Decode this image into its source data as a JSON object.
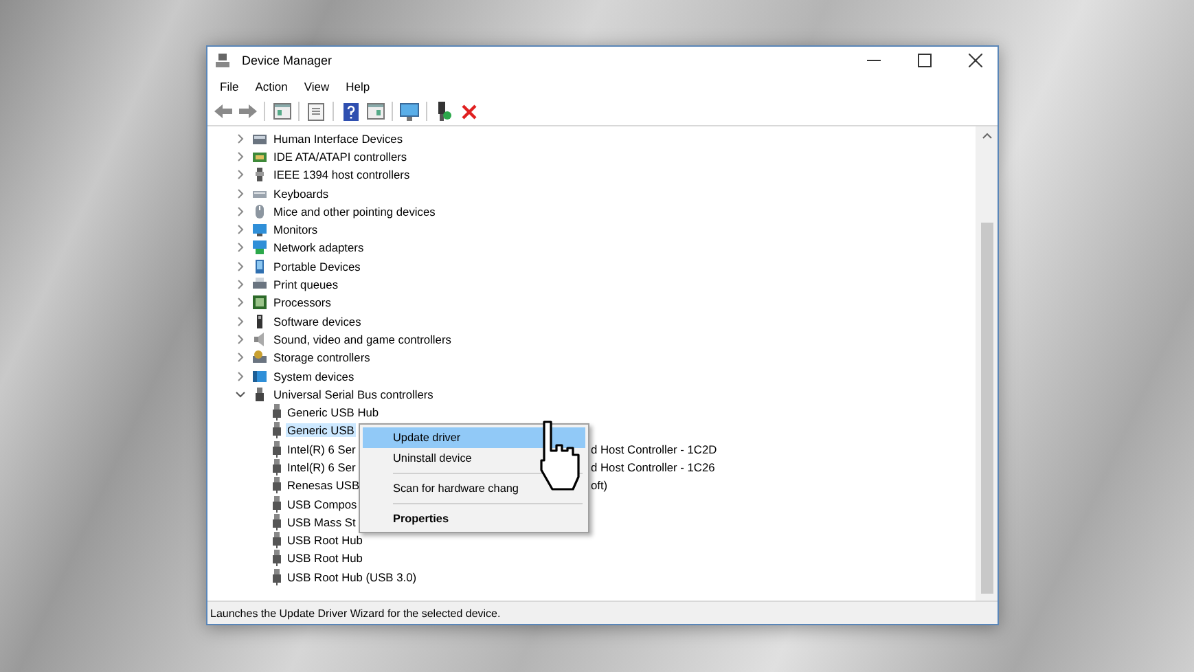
{
  "window": {
    "title": "Device Manager"
  },
  "menu_bar": [
    "File",
    "Action",
    "View",
    "Help"
  ],
  "tree": {
    "items": [
      {
        "label": "Human Interface Devices",
        "expanded": false
      },
      {
        "label": "IDE ATA/ATAPI controllers",
        "expanded": false
      },
      {
        "label": "IEEE 1394 host controllers",
        "expanded": false
      },
      {
        "label": "Keyboards",
        "expanded": false
      },
      {
        "label": "Mice and other pointing devices",
        "expanded": false
      },
      {
        "label": "Monitors",
        "expanded": false
      },
      {
        "label": "Network adapters",
        "expanded": false
      },
      {
        "label": "Portable Devices",
        "expanded": false
      },
      {
        "label": "Print queues",
        "expanded": false
      },
      {
        "label": "Processors",
        "expanded": false
      },
      {
        "label": "Software devices",
        "expanded": false
      },
      {
        "label": "Sound, video and game controllers",
        "expanded": false
      },
      {
        "label": "Storage controllers",
        "expanded": false
      },
      {
        "label": "System devices",
        "expanded": false
      },
      {
        "label": "Universal Serial Bus controllers",
        "expanded": true,
        "children": [
          {
            "label": "Generic USB Hub",
            "selected": false
          },
          {
            "label": "Generic USB",
            "selected": true
          },
          {
            "label": "Intel(R) 6 Ser",
            "tail": "d Host Controller - 1C2D",
            "selected": false
          },
          {
            "label": "Intel(R) 6 Ser",
            "tail": "d Host Controller - 1C26",
            "selected": false
          },
          {
            "label": "Renesas USB",
            "tail": "oft)",
            "selected": false
          },
          {
            "label": "USB Compos",
            "selected": false
          },
          {
            "label": "USB Mass St",
            "selected": false
          },
          {
            "label": "USB Root Hub",
            "selected": false
          },
          {
            "label": "USB Root Hub",
            "selected": false
          },
          {
            "label": "USB Root Hub (USB 3.0)",
            "selected": false
          }
        ]
      }
    ]
  },
  "context_menu": {
    "items": [
      {
        "label": "Update driver",
        "kind": "item",
        "selected": true
      },
      {
        "label": "Uninstall device",
        "kind": "item",
        "selected": false
      },
      {
        "kind": "separator"
      },
      {
        "label": "Scan for hardware chang",
        "kind": "item",
        "selected": false
      },
      {
        "kind": "separator"
      },
      {
        "label": "Properties",
        "kind": "default",
        "selected": false
      }
    ]
  },
  "status_bar": "Launches the Update Driver Wizard for the selected device."
}
